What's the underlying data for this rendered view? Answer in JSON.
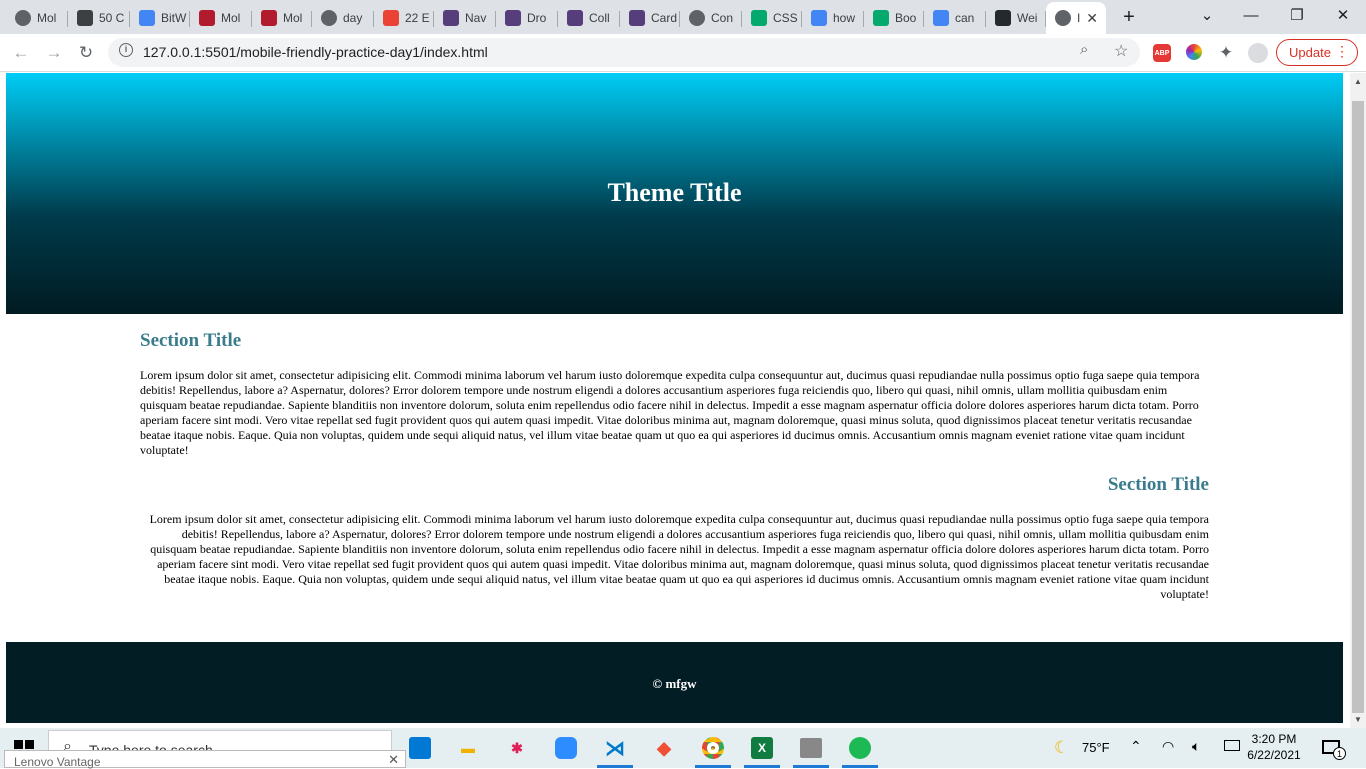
{
  "browser": {
    "tabs": [
      {
        "label": "Mol",
        "favicon": "globe-icon",
        "color": "#5f6368"
      },
      {
        "label": "50 C",
        "favicon": "photo-icon",
        "color": "#3c4043"
      },
      {
        "label": "BitW",
        "favicon": "docs-icon",
        "color": "#4285f4"
      },
      {
        "label": "Mol",
        "favicon": "w-icon",
        "color": "#b21a2e"
      },
      {
        "label": "Mol",
        "favicon": "w-icon",
        "color": "#b21a2e"
      },
      {
        "label": "day",
        "favicon": "globe-icon",
        "color": "#5f6368"
      },
      {
        "label": "22 E",
        "favicon": "gmail-icon",
        "color": "#ea4335"
      },
      {
        "label": "Nav",
        "favicon": "bootstrap-icon",
        "color": "#563d7c"
      },
      {
        "label": "Dro",
        "favicon": "bootstrap-icon",
        "color": "#563d7c"
      },
      {
        "label": "Coll",
        "favicon": "bootstrap-icon",
        "color": "#563d7c"
      },
      {
        "label": "Card",
        "favicon": "bootstrap-icon",
        "color": "#563d7c"
      },
      {
        "label": "Con",
        "favicon": "globe-icon",
        "color": "#5f6368"
      },
      {
        "label": "CSS",
        "favicon": "w3schools-icon",
        "color": "#04aa6d"
      },
      {
        "label": "how",
        "favicon": "google-icon",
        "color": "#4285f4"
      },
      {
        "label": "Boo",
        "favicon": "w3schools-icon",
        "color": "#04aa6d"
      },
      {
        "label": "can",
        "favicon": "google-icon",
        "color": "#4285f4"
      },
      {
        "label": "Wei",
        "favicon": "github-icon",
        "color": "#24292e"
      },
      {
        "label": "I",
        "favicon": "globe-icon",
        "color": "#5f6368",
        "active": true
      }
    ],
    "new_tab": "+",
    "url": "127.0.0.1:5501/mobile-friendly-practice-day1/index.html",
    "update_label": "Update",
    "abp_label": "ABP"
  },
  "page": {
    "hero_title": "Theme Title",
    "sections": [
      {
        "title": "Section Title",
        "align": "left",
        "body": "Lorem ipsum dolor sit amet, consectetur adipisicing elit. Commodi minima laborum vel harum iusto doloremque expedita culpa consequuntur aut, ducimus quasi repudiandae nulla possimus optio fuga saepe quia tempora debitis! Repellendus, labore a? Aspernatur, dolores? Error dolorem tempore unde nostrum eligendi a dolores accusantium asperiores fuga reiciendis quo, libero qui quasi, nihil omnis, ullam mollitia quibusdam enim quisquam beatae repudiandae. Sapiente blanditiis non inventore dolorum, soluta enim repellendus odio facere nihil in delectus. Impedit a esse magnam aspernatur officia dolore dolores asperiores harum dicta totam. Porro aperiam facere sint modi. Vero vitae repellat sed fugit provident quos qui autem quasi impedit. Vitae doloribus minima aut, magnam doloremque, quasi minus soluta, quod dignissimos placeat tenetur veritatis recusandae beatae itaque nobis. Eaque. Quia non voluptas, quidem unde sequi aliquid natus, vel illum vitae beatae quam ut quo ea qui asperiores id ducimus omnis. Accusantium omnis magnam eveniet ratione vitae quam incidunt voluptate!"
      },
      {
        "title": "Section Title",
        "align": "right",
        "body": "Lorem ipsum dolor sit amet, consectetur adipisicing elit. Commodi minima laborum vel harum iusto doloremque expedita culpa consequuntur aut, ducimus quasi repudiandae nulla possimus optio fuga saepe quia tempora debitis! Repellendus, labore a? Aspernatur, dolores? Error dolorem tempore unde nostrum eligendi a dolores accusantium asperiores fuga reiciendis quo, libero qui quasi, nihil omnis, ullam mollitia quibusdam enim quisquam beatae repudiandae. Sapiente blanditiis non inventore dolorum, soluta enim repellendus odio facere nihil in delectus. Impedit a esse magnam aspernatur officia dolore dolores asperiores harum dicta totam. Porro aperiam facere sint modi. Vero vitae repellat sed fugit provident quos qui autem quasi impedit. Vitae doloribus minima aut, magnam doloremque, quasi minus soluta, quod dignissimos placeat tenetur veritatis recusandae beatae itaque nobis. Eaque. Quia non voluptas, quidem unde sequi aliquid natus, vel illum vitae beatae quam ut quo ea qui asperiores id ducimus omnis. Accusantium omnis magnam eveniet ratione vitae quam incidunt voluptate!"
      }
    ],
    "footer": "© mfgw",
    "colors": {
      "section_title": "#3a7c8c",
      "hero_top": "#00cdf6",
      "footer_bg": "#021d24"
    }
  },
  "taskbar": {
    "search_placeholder": "Type here to search",
    "apps": [
      "file-explorer-icon",
      "slack-icon",
      "zoom-icon",
      "vscode-icon",
      "git-icon",
      "chrome-icon",
      "excel-icon",
      "app-icon",
      "spotify-icon"
    ],
    "weather": "75°F",
    "time": "3:20 PM",
    "date": "6/22/2021",
    "notification_count": "1",
    "lenovo_popup": "Lenovo Vantage"
  }
}
